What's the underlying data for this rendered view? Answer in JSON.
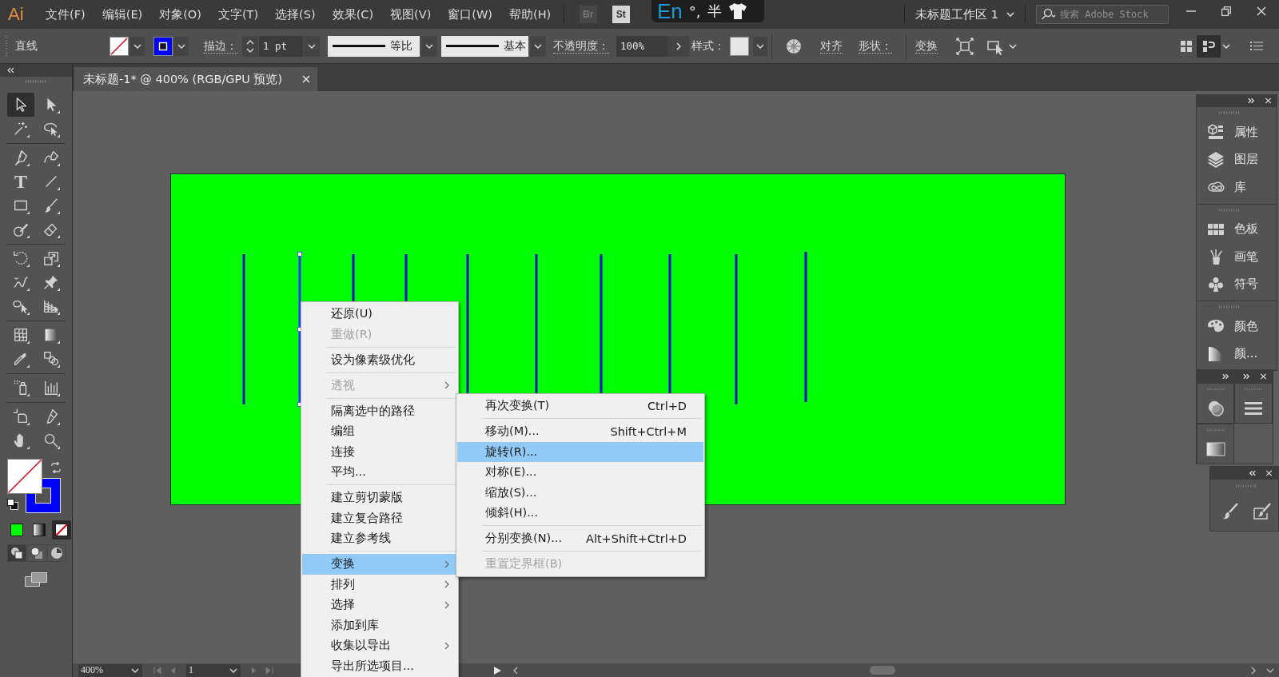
{
  "menu_bar": {
    "logo": "Ai",
    "menus": [
      "文件(F)",
      "编辑(E)",
      "对象(O)",
      "文字(T)",
      "选择(S)",
      "效果(C)",
      "视图(V)",
      "窗口(W)",
      "帮助(H)"
    ],
    "bridge_buttons": [
      {
        "label": "Br",
        "disabled": true
      },
      {
        "label": "St",
        "disabled": false
      }
    ],
    "ime_bar": {
      "language": "En",
      "punctuation": "°,",
      "width_mode": "半"
    },
    "workspace": "未标题工作区 1",
    "search": {
      "placeholder": "搜索 Adobe Stock"
    }
  },
  "control_bar": {
    "tool_name": "直线",
    "stroke_label": "描边：",
    "stroke_weight": "1 pt",
    "stroke_profile": "等比",
    "brush": "基本",
    "opacity_label": "不透明度：",
    "opacity": "100%",
    "style_label": "样式：",
    "align_link": "对齐",
    "shape_link": "形状：",
    "transform_link": "变换",
    "panel_buttons": [
      {
        "kind": "grid",
        "selected": false
      },
      {
        "kind": "dock",
        "selected": true
      }
    ]
  },
  "document_tab": {
    "title": "未标题-1* @ 400% (RGB/GPU 预览)",
    "selected": true
  },
  "tools": [
    {
      "kind": "select",
      "selected": true
    },
    {
      "kind": "direct",
      "selected": false
    },
    {
      "kind": "wand",
      "selected": false
    },
    {
      "kind": "lasso",
      "selected": false
    },
    {
      "kind": "pen",
      "selected": false
    },
    {
      "kind": "curvature",
      "selected": false
    },
    {
      "kind": "type",
      "glyph": "T",
      "selected": false
    },
    {
      "kind": "line",
      "selected": false
    },
    {
      "kind": "rect",
      "selected": false
    },
    {
      "kind": "brush",
      "selected": false
    },
    {
      "kind": "shaper",
      "selected": false
    },
    {
      "kind": "eraser",
      "selected": false
    },
    {
      "kind": "rotate",
      "selected": false
    },
    {
      "kind": "scale",
      "selected": false
    },
    {
      "kind": "width",
      "selected": false
    },
    {
      "kind": "pin",
      "selected": false
    },
    {
      "kind": "builder",
      "selected": false
    },
    {
      "kind": "perspective",
      "selected": false
    },
    {
      "kind": "mesh",
      "selected": false
    },
    {
      "kind": "gradient",
      "selected": false
    },
    {
      "kind": "eyedropper",
      "selected": false
    },
    {
      "kind": "blend",
      "selected": false
    },
    {
      "kind": "sprayer",
      "selected": false
    },
    {
      "kind": "graph",
      "selected": false
    },
    {
      "kind": "artboard",
      "selected": false
    },
    {
      "kind": "knife",
      "selected": false
    },
    {
      "kind": "hand",
      "selected": false
    },
    {
      "kind": "zoom",
      "selected": false
    }
  ],
  "color_modes": [
    {
      "kind": "color",
      "selected": false
    },
    {
      "kind": "gradient",
      "selected": false
    },
    {
      "kind": "none",
      "selected": true
    }
  ],
  "draw_modes": [
    {
      "kind": "normal",
      "selected": true
    },
    {
      "kind": "behind",
      "selected": false
    },
    {
      "kind": "inside",
      "selected": false
    }
  ],
  "artwork": {
    "lines": [
      {
        "selected": false
      },
      {
        "selected": true
      },
      {
        "selected": false
      },
      {
        "selected": false
      },
      {
        "selected": false
      },
      {
        "selected": false
      },
      {
        "selected": false
      },
      {
        "selected": false
      },
      {
        "selected": false
      },
      {
        "selected": false
      }
    ]
  },
  "status_bar": {
    "zoom": "400%",
    "artboard": "1"
  },
  "panels": [
    {
      "items": [
        {
          "kind": "properties",
          "label": "属性"
        },
        {
          "kind": "layers",
          "label": "图层"
        },
        {
          "kind": "libraries",
          "label": "库"
        }
      ]
    },
    {
      "items": [
        {
          "kind": "swatches",
          "label": "色板"
        },
        {
          "kind": "brushes",
          "label": "画笔"
        },
        {
          "kind": "symbols",
          "label": "符号"
        }
      ]
    },
    {
      "items": [
        {
          "kind": "color",
          "label": "颜色"
        },
        {
          "kind": "guide",
          "label": "颜..."
        }
      ]
    }
  ],
  "context_menu": {
    "items": [
      {
        "kind": "item",
        "label": "还原(U)",
        "disabled": false,
        "submenu": false,
        "selected": false
      },
      {
        "kind": "item",
        "label": "重做(R)",
        "disabled": true,
        "submenu": false,
        "selected": false
      },
      {
        "kind": "separator"
      },
      {
        "kind": "item",
        "label": "设为像素级优化",
        "disabled": false,
        "submenu": false,
        "selected": false
      },
      {
        "kind": "separator"
      },
      {
        "kind": "item",
        "label": "透视",
        "disabled": true,
        "submenu": true,
        "selected": false
      },
      {
        "kind": "separator"
      },
      {
        "kind": "item",
        "label": "隔离选中的路径",
        "disabled": false,
        "submenu": false,
        "selected": false
      },
      {
        "kind": "item",
        "label": "编组",
        "disabled": false,
        "submenu": false,
        "selected": false
      },
      {
        "kind": "item",
        "label": "连接",
        "disabled": false,
        "submenu": false,
        "selected": false
      },
      {
        "kind": "item",
        "label": "平均...",
        "disabled": false,
        "submenu": false,
        "selected": false
      },
      {
        "kind": "separator"
      },
      {
        "kind": "item",
        "label": "建立剪切蒙版",
        "disabled": false,
        "submenu": false,
        "selected": false
      },
      {
        "kind": "item",
        "label": "建立复合路径",
        "disabled": false,
        "submenu": false,
        "selected": false
      },
      {
        "kind": "item",
        "label": "建立参考线",
        "disabled": false,
        "submenu": false,
        "selected": false
      },
      {
        "kind": "separator"
      },
      {
        "kind": "item",
        "label": "变换",
        "disabled": false,
        "submenu": true,
        "selected": true
      },
      {
        "kind": "item",
        "label": "排列",
        "disabled": false,
        "submenu": true,
        "selected": false
      },
      {
        "kind": "item",
        "label": "选择",
        "disabled": false,
        "submenu": true,
        "selected": false
      },
      {
        "kind": "item",
        "label": "添加到库",
        "disabled": false,
        "submenu": false,
        "selected": false
      },
      {
        "kind": "item",
        "label": "收集以导出",
        "disabled": false,
        "submenu": true,
        "selected": false
      },
      {
        "kind": "item",
        "label": "导出所选项目...",
        "disabled": false,
        "submenu": false,
        "selected": false
      }
    ]
  },
  "submenu": {
    "items": [
      {
        "kind": "item",
        "label": "再次变换(T)",
        "shortcut": "Ctrl+D",
        "disabled": false,
        "selected": false
      },
      {
        "kind": "separator"
      },
      {
        "kind": "item",
        "label": "移动(M)...",
        "shortcut": "Shift+Ctrl+M",
        "disabled": false,
        "selected": false
      },
      {
        "kind": "item",
        "label": "旋转(R)...",
        "disabled": false,
        "selected": true
      },
      {
        "kind": "item",
        "label": "对称(E)...",
        "disabled": false,
        "selected": false
      },
      {
        "kind": "item",
        "label": "缩放(S)...",
        "disabled": false,
        "selected": false
      },
      {
        "kind": "item",
        "label": "倾斜(H)...",
        "disabled": false,
        "selected": false
      },
      {
        "kind": "separator"
      },
      {
        "kind": "item",
        "label": "分别变换(N)...",
        "shortcut": "Alt+Shift+Ctrl+D",
        "disabled": false,
        "selected": false
      },
      {
        "kind": "separator"
      },
      {
        "kind": "item",
        "label": "重置定界框(B)",
        "disabled": true,
        "selected": false
      }
    ]
  }
}
